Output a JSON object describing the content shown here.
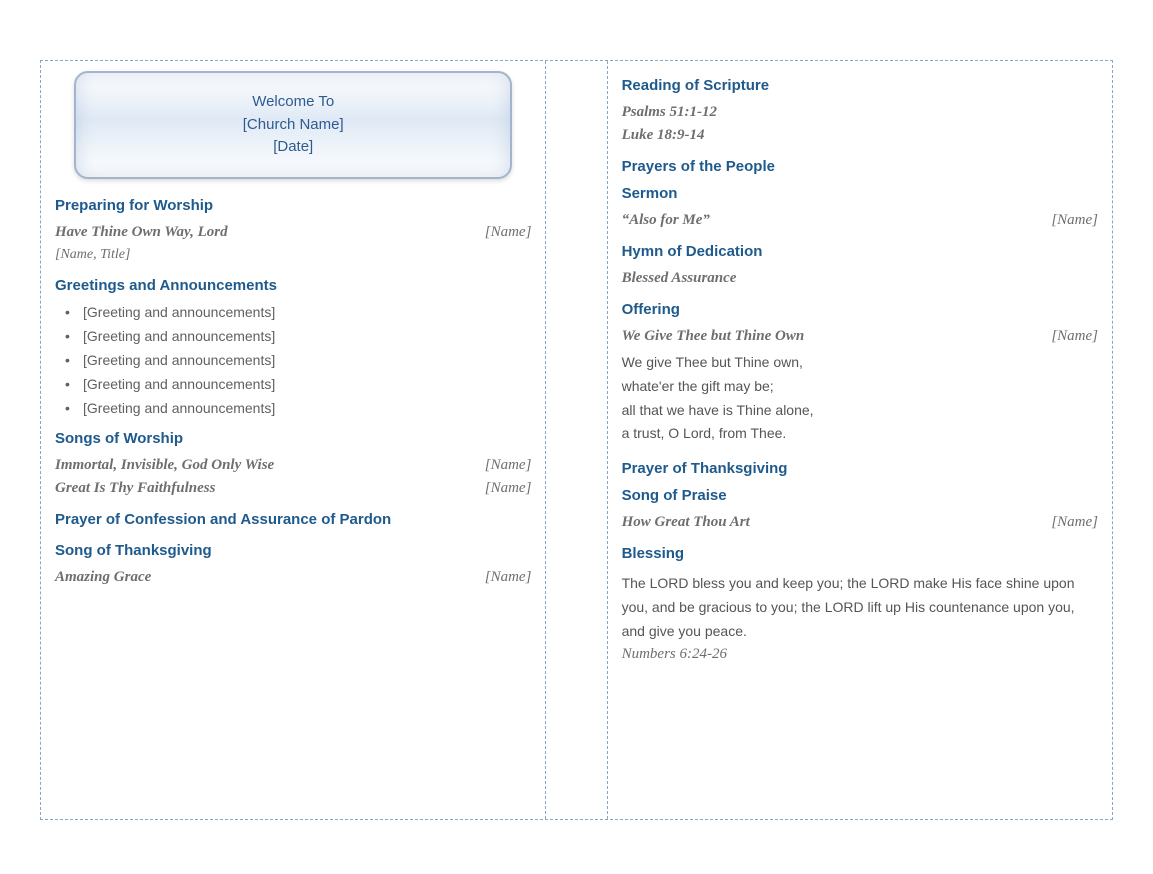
{
  "welcome": {
    "line1": "Welcome To",
    "line2": "[Church Name]",
    "line3": "[Date]"
  },
  "left": {
    "preparing_header": "Preparing for Worship",
    "preparing_hymn": "Have Thine Own Way, Lord",
    "preparing_name": "[Name]",
    "preparing_sub": "[Name, Title]",
    "greetings_header": "Greetings and Announcements",
    "announcements": [
      "[Greeting and announcements]",
      "[Greeting and announcements]",
      "[Greeting and announcements]",
      "[Greeting and announcements]",
      "[Greeting and announcements]"
    ],
    "songs_header": "Songs of Worship",
    "song1_title": "Immortal, Invisible, God Only Wise",
    "song1_name": "[Name]",
    "song2_title": "Great Is Thy Faithfulness",
    "song2_name": "[Name]",
    "confession_header": "Prayer of Confession and Assurance of Pardon",
    "thanksgiving_header": "Song of Thanksgiving",
    "thanksgiving_hymn": "Amazing Grace",
    "thanksgiving_name": "[Name]"
  },
  "right": {
    "reading_header": "Reading of Scripture",
    "scripture1": "Psalms 51:1-12",
    "scripture2": "Luke 18:9-14",
    "prayers_header": "Prayers of the People",
    "sermon_header": "Sermon",
    "sermon_title": "“Also for Me”",
    "sermon_name": "[Name]",
    "dedication_header": "Hymn of Dedication",
    "dedication_hymn": "Blessed Assurance",
    "offering_header": "Offering",
    "offering_hymn": "We Give Thee but Thine Own",
    "offering_name": "[Name]",
    "offering_verse": "We give Thee but Thine own,\nwhate'er the gift may be;\nall that we have is Thine alone,\na trust, O Lord, from Thee.",
    "prayer_thanks_header": "Prayer of Thanksgiving",
    "praise_header": "Song of Praise",
    "praise_hymn": "How Great Thou Art",
    "praise_name": "[Name]",
    "blessing_header": "Blessing",
    "blessing_text": "The LORD bless you and keep you; the LORD make His face shine upon you, and be gracious to you; the LORD lift up His countenance upon you, and give you peace.",
    "blessing_ref": "Numbers 6:24-26"
  }
}
